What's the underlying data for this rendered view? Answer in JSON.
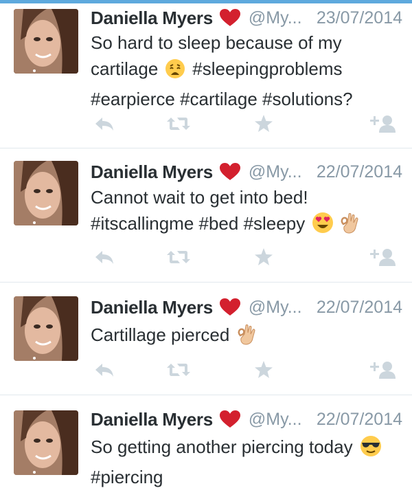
{
  "colors": {
    "accent": "#5ea9dd",
    "name": "#292f33",
    "muted": "#8899a6",
    "action_icon": "#ccd6dd",
    "heart": "#d3202e"
  },
  "icons": {
    "verified_like": "heart-icon",
    "reply": "reply-icon",
    "retweet": "retweet-icon",
    "favorite": "star-icon",
    "follow": "follow-icon"
  },
  "tweets": [
    {
      "name": "Daniella Myers",
      "handle": "@My...",
      "date": "23/07/2014",
      "lines": [
        "So hard to sleep because of my",
        "cartilage",
        "#sleepingproblems",
        "#earpierce #cartilage #solutions?"
      ]
    },
    {
      "name": "Daniella Myers",
      "handle": "@My...",
      "date": "22/07/2014",
      "lines": [
        "Cannot wait to get into bed!",
        "#itscallingme #bed #sleepy"
      ]
    },
    {
      "name": "Daniella Myers",
      "handle": "@My...",
      "date": "22/07/2014",
      "lines": [
        "Cartillage pierced"
      ]
    },
    {
      "name": "Daniella Myers",
      "handle": "@My...",
      "date": "22/07/2014",
      "lines": [
        "So getting another piercing today",
        "#piercing"
      ]
    }
  ]
}
